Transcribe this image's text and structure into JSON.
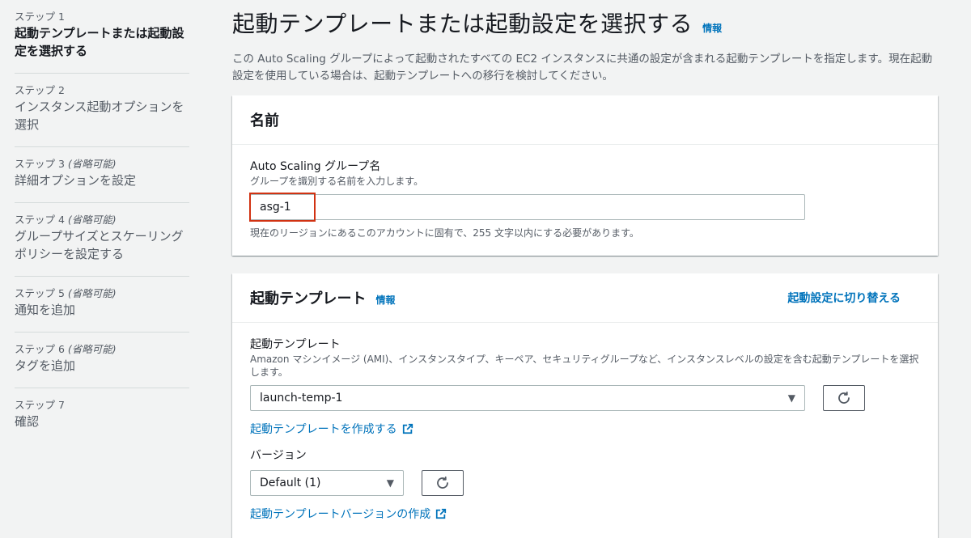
{
  "sidebar": {
    "steps": [
      {
        "label": "ステップ 1",
        "optional": "",
        "title": "起動テンプレートまたは起動設定を選択する"
      },
      {
        "label": "ステップ 2",
        "optional": "",
        "title": "インスタンス起動オプションを選択"
      },
      {
        "label": "ステップ 3",
        "optional": "(省略可能)",
        "title": "詳細オプションを設定"
      },
      {
        "label": "ステップ 4",
        "optional": "(省略可能)",
        "title": "グループサイズとスケーリングポリシーを設定する"
      },
      {
        "label": "ステップ 5",
        "optional": "(省略可能)",
        "title": "通知を追加"
      },
      {
        "label": "ステップ 6",
        "optional": "(省略可能)",
        "title": "タグを追加"
      },
      {
        "label": "ステップ 7",
        "optional": "",
        "title": "確認"
      }
    ]
  },
  "header": {
    "title": "起動テンプレートまたは起動設定を選択する",
    "info": "情報",
    "description": "この Auto Scaling グループによって起動されたすべての EC2 インスタンスに共通の設定が含まれる起動テンプレートを指定します。現在起動設定を使用している場合は、起動テンプレートへの移行を検討してください。"
  },
  "name_panel": {
    "title": "名前",
    "field_label": "Auto Scaling グループ名",
    "field_desc": "グループを識別する名前を入力します。",
    "value": "asg-1",
    "constraint": "現在のリージョンにあるこのアカウントに固有で、255 文字以内にする必要があります。"
  },
  "template_panel": {
    "title": "起動テンプレート",
    "info": "情報",
    "switch_link": "起動設定に切り替える",
    "field_label": "起動テンプレート",
    "field_desc": "Amazon マシンイメージ (AMI)、インスタンスタイプ、キーペア、セキュリティグループなど、インスタンスレベルの設定を含む起動テンプレートを選択します。",
    "selected": "launch-temp-1",
    "create_link": "起動テンプレートを作成する",
    "version_label": "バージョン",
    "version_selected": "Default (1)",
    "create_version_link": "起動テンプレートバージョンの作成"
  },
  "colors": {
    "accent": "#0073bb",
    "highlight": "#d13212"
  }
}
